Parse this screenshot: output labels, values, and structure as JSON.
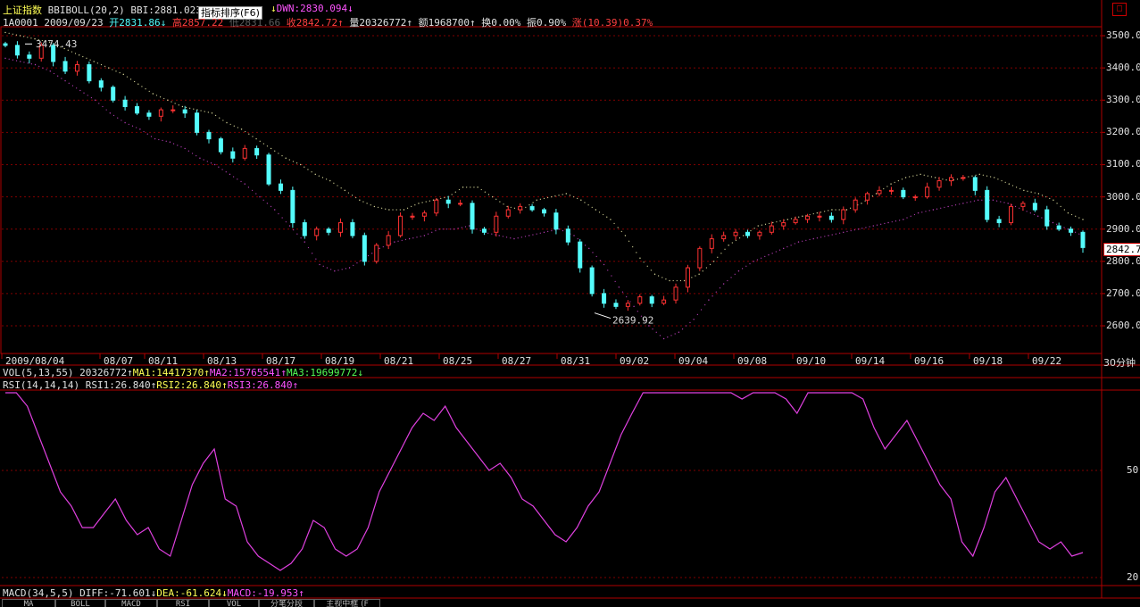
{
  "header": {
    "index_name": "上证指数",
    "indicator": "BBIBOLL(20,2)",
    "bbi": "BBI:2881.023",
    "bbi_arrow": "↓",
    "tooltip": "指标排序(F6)",
    "dwn": "DWN:2830.094",
    "dwn_arrow": "↓"
  },
  "quote": {
    "code_date": "1A0001 2009/09/23",
    "open": "开2831.86",
    "open_arrow": "↓",
    "high": "高2857.22",
    "low": "低2831.66",
    "close": "收2842.72",
    "close_arrow": "↑",
    "volume": "量20326772",
    "vol_arrow": "↑",
    "amount": "额1968700",
    "amt_arrow": "↑",
    "turnover": "换0.00%",
    "amplitude": "振0.90%",
    "change": "涨(10.39)0.37%"
  },
  "price_axis": {
    "ticks": [
      "3500.0",
      "3400.0",
      "3300.0",
      "3200.0",
      "3100.0",
      "3000.0",
      "2900.0",
      "2800.0",
      "2700.0",
      "2600.0"
    ],
    "current_price": "2842.7"
  },
  "annotations": {
    "high_label": "3474.43",
    "low_label": "2639.92"
  },
  "date_axis": {
    "labels": [
      "2009/08/04",
      "08/07",
      "08/11",
      "08/13",
      "08/17",
      "08/19",
      "08/21",
      "08/25",
      "08/27",
      "08/31",
      "09/02",
      "09/04",
      "09/08",
      "09/10",
      "09/14",
      "09/16",
      "09/18",
      "09/22"
    ],
    "period": "30分钟"
  },
  "vol_bar": {
    "label": "VOL(5,13,55)",
    "value": "20326772",
    "value_arrow": "↑",
    "ma1": "MA1:14417370",
    "ma1_arrow": "↑",
    "ma2": "MA2:15765541",
    "ma2_arrow": "↑",
    "ma3": "MA3:19699772",
    "ma3_arrow": "↓"
  },
  "rsi_bar": {
    "label": "RSI(14,14,14)",
    "rsi1": "RSI1:26.840",
    "rsi1_arrow": "↑",
    "rsi2": "RSI2:26.840",
    "rsi2_arrow": "↑",
    "rsi3": "RSI3:26.840",
    "rsi3_arrow": "↑"
  },
  "rsi_axis": {
    "ticks": [
      "50",
      "20"
    ]
  },
  "macd_bar": {
    "label": "MACD(34,5,5)",
    "diff": "DIFF:-71.601",
    "diff_arrow": "↓",
    "dea": "DEA:-61.624",
    "dea_arrow": "↓",
    "macd": "MACD:-19.953",
    "macd_arrow": "↑"
  },
  "tabs": [
    "MA",
    "BOLL",
    "MACD",
    "RSI",
    "VOL",
    "分笔分段",
    "主视中框 (F"
  ],
  "colors": {
    "up": "#ff3232",
    "down": "#54fcfc",
    "upper_band": "#e0e0a0",
    "lower_band": "#c040c0",
    "rsi_line": "#e040e0",
    "grid": "#800000",
    "frame": "#b00000"
  },
  "chart_data": [
    {
      "type": "candlestick",
      "title": "上证指数 BBIBOLL(20,2)",
      "ylim": [
        2550,
        3550
      ],
      "period": "30分钟",
      "x_labels": [
        "2009/08/04",
        "08/07",
        "08/11",
        "08/13",
        "08/17",
        "08/19",
        "08/21",
        "08/25",
        "08/27",
        "08/31",
        "09/02",
        "09/04",
        "09/08",
        "09/10",
        "09/14",
        "09/16",
        "09/18",
        "09/22"
      ],
      "close_path": [
        3470,
        3440,
        3430,
        3470,
        3420,
        3390,
        3410,
        3360,
        3340,
        3300,
        3280,
        3260,
        3250,
        3270,
        3270,
        3260,
        3200,
        3180,
        3140,
        3120,
        3150,
        3130,
        3040,
        3020,
        2920,
        2880,
        2900,
        2890,
        2920,
        2880,
        2800,
        2850,
        2880,
        2940,
        2940,
        2950,
        2990,
        2980,
        2980,
        2900,
        2890,
        2940,
        2960,
        2970,
        2960,
        2950,
        2900,
        2860,
        2780,
        2700,
        2670,
        2660,
        2670,
        2690,
        2670,
        2680,
        2720,
        2780,
        2840,
        2870,
        2880,
        2890,
        2880,
        2890,
        2910,
        2920,
        2930,
        2940,
        2940,
        2930,
        2960,
        2990,
        3010,
        3020,
        3020,
        3000,
        3000,
        3030,
        3050,
        3060,
        3060,
        3020,
        2930,
        2920,
        2970,
        2980,
        2960,
        2910,
        2900,
        2890,
        2842.72
      ],
      "upper_band_path": [
        3510,
        3500,
        3490,
        3480,
        3460,
        3440,
        3420,
        3400,
        3380,
        3350,
        3320,
        3300,
        3280,
        3270,
        3260,
        3230,
        3210,
        3180,
        3150,
        3120,
        3100,
        3070,
        3050,
        3020,
        2990,
        2970,
        2960,
        2960,
        2980,
        2990,
        3000,
        3030,
        3030,
        3000,
        2970,
        2960,
        2990,
        3000,
        3010,
        2990,
        2960,
        2930,
        2880,
        2810,
        2760,
        2740,
        2740,
        2760,
        2800,
        2850,
        2880,
        2910,
        2920,
        2930,
        2940,
        2950,
        2960,
        2960,
        2980,
        3010,
        3040,
        3060,
        3070,
        3060,
        3050,
        3060,
        3070,
        3060,
        3040,
        3020,
        3010,
        2990,
        2950,
        2930
      ],
      "lower_band_path": [
        3430,
        3420,
        3410,
        3390,
        3360,
        3330,
        3300,
        3260,
        3230,
        3210,
        3180,
        3170,
        3150,
        3120,
        3100,
        3070,
        3040,
        3000,
        2960,
        2910,
        2860,
        2790,
        2770,
        2780,
        2810,
        2840,
        2860,
        2870,
        2880,
        2900,
        2900,
        2910,
        2890,
        2880,
        2870,
        2880,
        2890,
        2900,
        2880,
        2840,
        2790,
        2720,
        2660,
        2600,
        2560,
        2580,
        2620,
        2680,
        2730,
        2770,
        2800,
        2820,
        2840,
        2860,
        2870,
        2880,
        2890,
        2900,
        2910,
        2920,
        2930,
        2950,
        2960,
        2970,
        2980,
        2990,
        2990,
        2980,
        2960,
        2940,
        2920,
        2900,
        2880
      ],
      "annotations": [
        {
          "text": "3474.43",
          "value": 3474.43
        },
        {
          "text": "2639.92",
          "value": 2639.92
        }
      ],
      "last_price": 2842.7
    },
    {
      "type": "line",
      "title": "RSI(14,14,14)",
      "series": [
        {
          "name": "RSI1",
          "values": [
            78,
            72,
            68,
            60,
            52,
            44,
            40,
            34,
            34,
            38,
            42,
            36,
            32,
            34,
            28,
            26,
            36,
            46,
            52,
            56,
            42,
            40,
            30,
            26,
            24,
            22,
            24,
            28,
            36,
            34,
            28,
            26,
            28,
            34,
            44,
            50,
            56,
            62,
            66,
            64,
            68,
            62,
            58,
            54,
            50,
            52,
            48,
            42,
            40,
            36,
            32,
            30,
            34,
            40,
            44,
            52,
            60,
            66,
            72,
            76,
            78,
            82,
            80,
            84,
            78,
            74,
            72,
            70,
            78,
            82,
            76,
            70,
            66,
            72,
            76,
            80,
            84,
            80,
            70,
            62,
            56,
            60,
            64,
            58,
            52,
            46,
            42,
            30,
            26,
            34,
            44,
            48,
            42,
            36,
            30,
            28,
            30,
            26,
            27
          ]
        }
      ],
      "yticks": [
        "50",
        "20"
      ]
    }
  ]
}
